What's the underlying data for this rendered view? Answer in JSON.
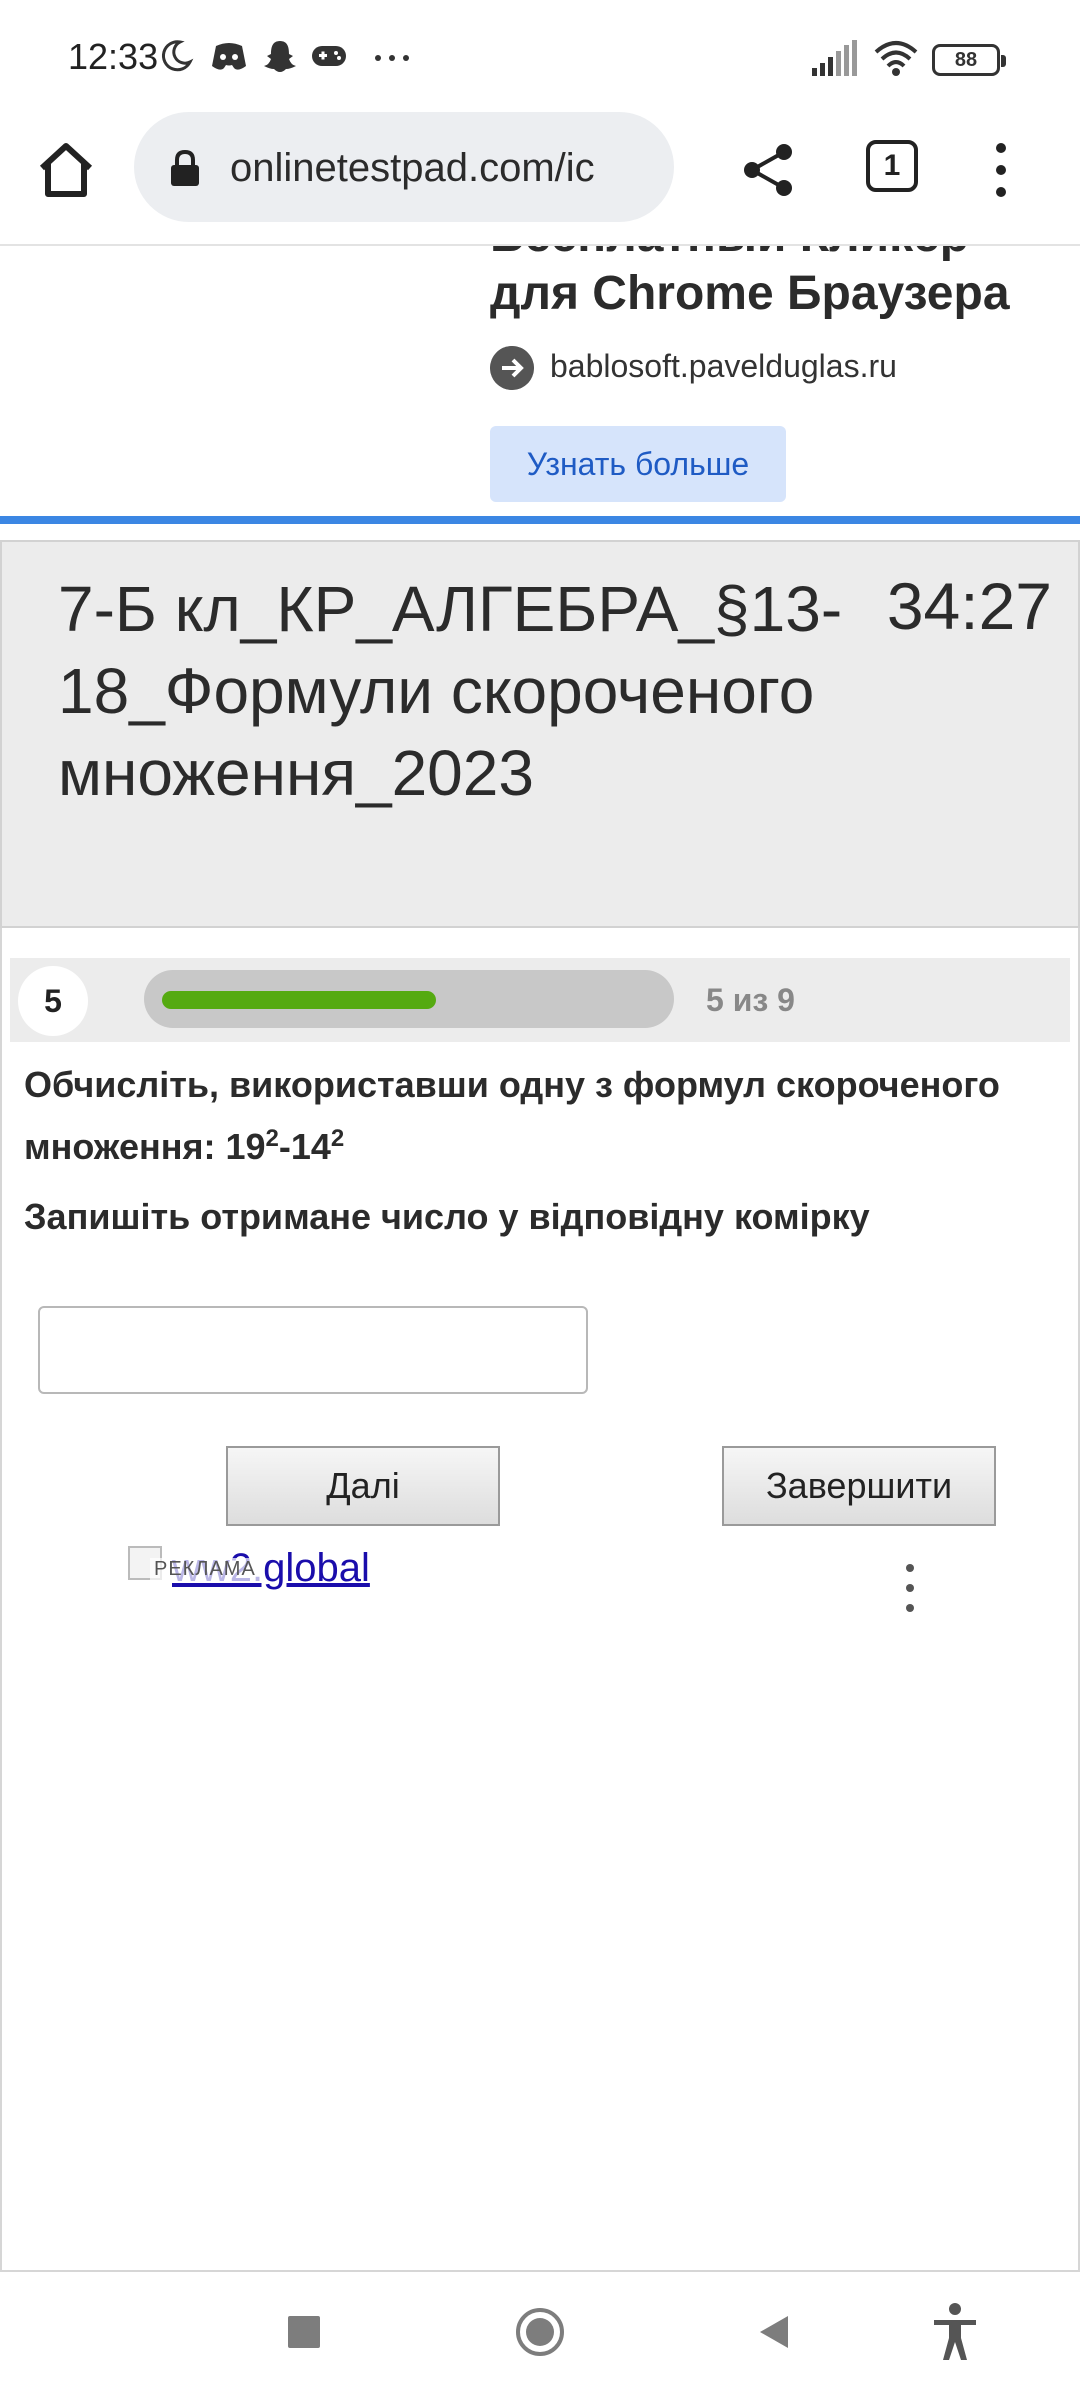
{
  "status_bar": {
    "time": "12:33",
    "battery": "88"
  },
  "browser": {
    "url": "onlinetestpad.com/ic",
    "tab_count": "1"
  },
  "ad": {
    "title_cut": "Бесплатный Кликер",
    "title": "для Chrome Браузера",
    "domain": "bablosoft.pavelduglas.ru",
    "cta": "Узнать больше"
  },
  "test": {
    "title": "7-Б кл_КР_АЛГЕБРА_§13-18_Формули скороченого множення_2023",
    "timer": "34:27"
  },
  "progress": {
    "question_number": "5",
    "label": "5 из 9",
    "fraction": 0.5555
  },
  "question": {
    "text": "Обчисліть, використавши одну з формул скороченого множення:  19",
    "exp1": "2",
    "mid": "-14",
    "exp2": "2",
    "instruction": "Запишіть отримане число у відповідну комірку",
    "answer_value": ""
  },
  "buttons": {
    "next": "Далі",
    "finish": "Завершити"
  },
  "bottom_ad": {
    "label": "РЕКЛАМА",
    "link": "ww2.global"
  },
  "colors": {
    "accent": "#3b86e3",
    "progress": "#55aa11",
    "cta_bg": "#d6e4fb"
  }
}
